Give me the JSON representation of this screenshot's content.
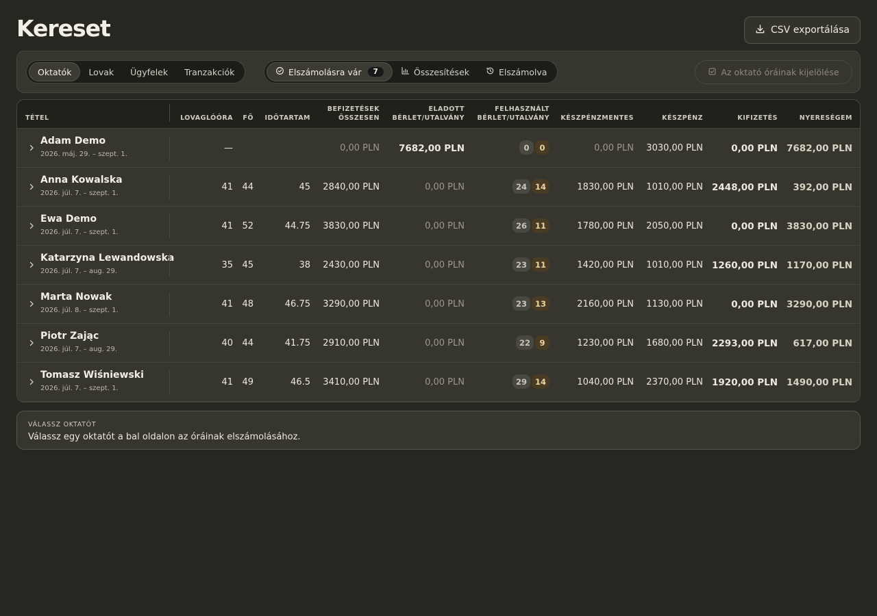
{
  "page": {
    "title": "Kereset"
  },
  "export_button": {
    "label": "CSV exportálása",
    "icon": "download-icon"
  },
  "tabs": [
    {
      "label": "Oktatók",
      "active": true
    },
    {
      "label": "Lovak",
      "active": false
    },
    {
      "label": "Ügyfelek",
      "active": false
    },
    {
      "label": "Tranzakciók",
      "active": false
    }
  ],
  "views": [
    {
      "label": "Elszámolásra vár",
      "icon": "check-circle-icon",
      "count": "7",
      "active": true
    },
    {
      "label": "Összesítések",
      "icon": "bar-chart-icon",
      "active": false
    },
    {
      "label": "Elszámolva",
      "icon": "history-icon",
      "active": false
    }
  ],
  "select_button": {
    "label": "Az oktató óráinak kijelölése",
    "icon": "checkbox-icon",
    "disabled": true
  },
  "table": {
    "headers": {
      "item": "TÉTEL",
      "lessons": "LOVAGLÓÓRA",
      "persons": "FŐ",
      "duration": "IDŐTARTAM",
      "payments_1": "BEFIZETÉSEK",
      "payments_2": "ÖSSZESEN",
      "sold_1": "ELADOTT",
      "sold_2": "BÉRLET/UTALVÁNY",
      "used_1": "FELHASZNÁLT",
      "used_2": "BÉRLET/UTALVÁNY",
      "cashless": "KÉSZPÉNZMENTES",
      "cash": "KÉSZPÉNZ",
      "payout": "KIFIZETÉS",
      "profit": "NYERESÉGEM"
    },
    "rows": [
      {
        "name": "Adam Demo",
        "date": "2026. máj. 29. – szept. 1.",
        "lessons": "—",
        "persons": "",
        "duration": "",
        "payments": "0,00 PLN",
        "sold": "7682,00 PLN",
        "used_a": "0",
        "used_b": "0",
        "cashless": "0,00 PLN",
        "cash": "3030,00 PLN",
        "payout": "0,00 PLN",
        "profit": "7682,00 PLN"
      },
      {
        "name": "Anna Kowalska",
        "date": "2026. júl. 7. – szept. 1.",
        "lessons": "41",
        "persons": "44",
        "duration": "45",
        "payments": "2840,00 PLN",
        "sold": "0,00 PLN",
        "used_a": "24",
        "used_b": "14",
        "cashless": "1830,00 PLN",
        "cash": "1010,00 PLN",
        "payout": "2448,00 PLN",
        "profit": "392,00 PLN"
      },
      {
        "name": "Ewa Demo",
        "date": "2026. júl. 7. – szept. 1.",
        "lessons": "41",
        "persons": "52",
        "duration": "44.75",
        "payments": "3830,00 PLN",
        "sold": "0,00 PLN",
        "used_a": "26",
        "used_b": "11",
        "cashless": "1780,00 PLN",
        "cash": "2050,00 PLN",
        "payout": "0,00 PLN",
        "profit": "3830,00 PLN"
      },
      {
        "name": "Katarzyna Lewandowska",
        "date": "2026. júl. 7. – aug. 29.",
        "lessons": "35",
        "persons": "45",
        "duration": "38",
        "payments": "2430,00 PLN",
        "sold": "0,00 PLN",
        "used_a": "23",
        "used_b": "11",
        "cashless": "1420,00 PLN",
        "cash": "1010,00 PLN",
        "payout": "1260,00 PLN",
        "profit": "1170,00 PLN"
      },
      {
        "name": "Marta Nowak",
        "date": "2026. júl. 8. – szept. 1.",
        "lessons": "41",
        "persons": "48",
        "duration": "46.75",
        "payments": "3290,00 PLN",
        "sold": "0,00 PLN",
        "used_a": "23",
        "used_b": "13",
        "cashless": "2160,00 PLN",
        "cash": "1130,00 PLN",
        "payout": "0,00 PLN",
        "profit": "3290,00 PLN"
      },
      {
        "name": "Piotr Zając",
        "date": "2026. júl. 7. – aug. 29.",
        "lessons": "40",
        "persons": "44",
        "duration": "41.75",
        "payments": "2910,00 PLN",
        "sold": "0,00 PLN",
        "used_a": "22",
        "used_b": "9",
        "cashless": "1230,00 PLN",
        "cash": "1680,00 PLN",
        "payout": "2293,00 PLN",
        "profit": "617,00 PLN"
      },
      {
        "name": "Tomasz Wiśniewski",
        "date": "2026. júl. 7. – szept. 1.",
        "lessons": "41",
        "persons": "49",
        "duration": "46.5",
        "payments": "3410,00 PLN",
        "sold": "0,00 PLN",
        "used_a": "29",
        "used_b": "14",
        "cashless": "1040,00 PLN",
        "cash": "2370,00 PLN",
        "payout": "1920,00 PLN",
        "profit": "1490,00 PLN"
      }
    ]
  },
  "info": {
    "caption": "VÁLASSZ OKTATÓT",
    "message": "Válassz egy oktatót a bal oldalon az óráinak elszámolásához."
  }
}
